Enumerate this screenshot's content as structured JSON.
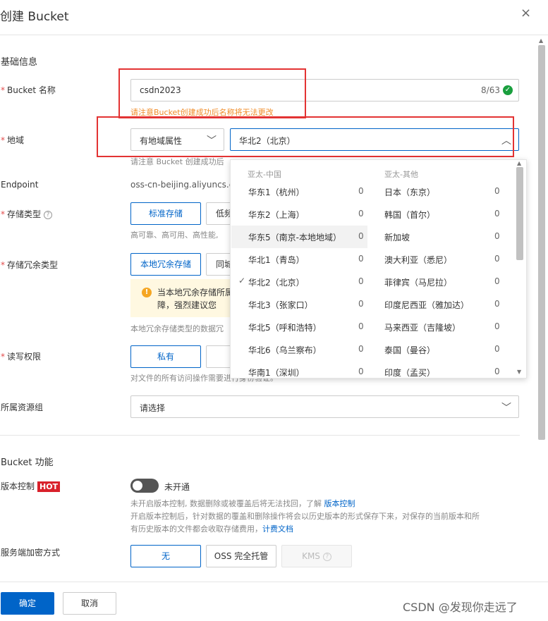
{
  "dialog": {
    "title": "创建 Bucket",
    "close_icon": "×"
  },
  "basic_section": "基础信息",
  "bucket_name": {
    "label": "Bucket 名称",
    "value": "csdn2023",
    "counter": "8/63",
    "warning": "请注意Bucket创建成功后名称将无法更改"
  },
  "region": {
    "label": "地域",
    "attr_select": "有地域属性",
    "region_select": "华北2（北京）",
    "hint": "请注意 Bucket 创建成功后"
  },
  "endpoint": {
    "label": "Endpoint",
    "value": "oss-cn-beijing.aliyuncs.com"
  },
  "storage_type": {
    "label": "存储类型",
    "options": [
      "标准存储",
      "低频"
    ],
    "hint": "高可靠、高可用、高性能,"
  },
  "redundancy": {
    "label": "存储冗余类型",
    "options": [
      "本地冗余存储",
      "同城"
    ],
    "alert": "当本地冗余存储所属性保障，强烈建议您",
    "hint": "本地冗余存储类型的数据冗"
  },
  "acl": {
    "label": "读写权限",
    "options": [
      "私有",
      ""
    ],
    "hint": "对文件的所有访问操作需要进行身份验证。"
  },
  "resource_group": {
    "label": "所属资源组",
    "placeholder": "请选择"
  },
  "function_section": "Bucket 功能",
  "versioning": {
    "label": "版本控制",
    "badge": "HOT",
    "state": "未开通",
    "desc1": "未开启版本控制, 数据删除或被覆盖后将无法找回，了解",
    "desc1_link": "版本控制",
    "desc2": "开启版本控制后，针对数据的覆盖和删除操作将会以历史版本的形式保存下来，对保存的当前版本和所",
    "desc3": "有历史版本的文件都会收取存储费用，",
    "desc3_link": "计费文档"
  },
  "encryption": {
    "label": "服务端加密方式",
    "options": [
      "无",
      "OSS 完全托管",
      "KMS"
    ]
  },
  "dropdown": {
    "group_left": "亚太-中国",
    "group_right": "亚太-其他",
    "left_items": [
      {
        "name": "华东1（杭州）",
        "count": "0"
      },
      {
        "name": "华东2（上海）",
        "count": "0"
      },
      {
        "name": "华东5（南京-本地地域）",
        "count": "0"
      },
      {
        "name": "华北1（青岛）",
        "count": "0"
      },
      {
        "name": "华北2（北京）",
        "count": "0"
      },
      {
        "name": "华北3（张家口）",
        "count": "0"
      },
      {
        "name": "华北5（呼和浩特）",
        "count": "0"
      },
      {
        "name": "华北6（乌兰察布）",
        "count": "0"
      },
      {
        "name": "华南1（深圳）",
        "count": "0"
      }
    ],
    "right_items": [
      {
        "name": "日本（东京）",
        "count": "0"
      },
      {
        "name": "韩国（首尔）",
        "count": "0"
      },
      {
        "name": "新加坡",
        "count": "0"
      },
      {
        "name": "澳大利亚（悉尼）",
        "count": "0"
      },
      {
        "name": "菲律宾（马尼拉）",
        "count": "0"
      },
      {
        "name": "印度尼西亚（雅加达）",
        "count": "0"
      },
      {
        "name": "马来西亚（吉隆坡）",
        "count": "0"
      },
      {
        "name": "泰国（曼谷）",
        "count": "0"
      },
      {
        "name": "印度（孟买）",
        "count": "0"
      }
    ]
  },
  "footer": {
    "confirm": "确定",
    "cancel": "取消"
  },
  "watermark": "CSDN @发现你走远了",
  "colors": {
    "primary": "#0064c8",
    "warning": "#f08b27",
    "hot": "#d9212b",
    "highlight_box": "#e33333"
  }
}
